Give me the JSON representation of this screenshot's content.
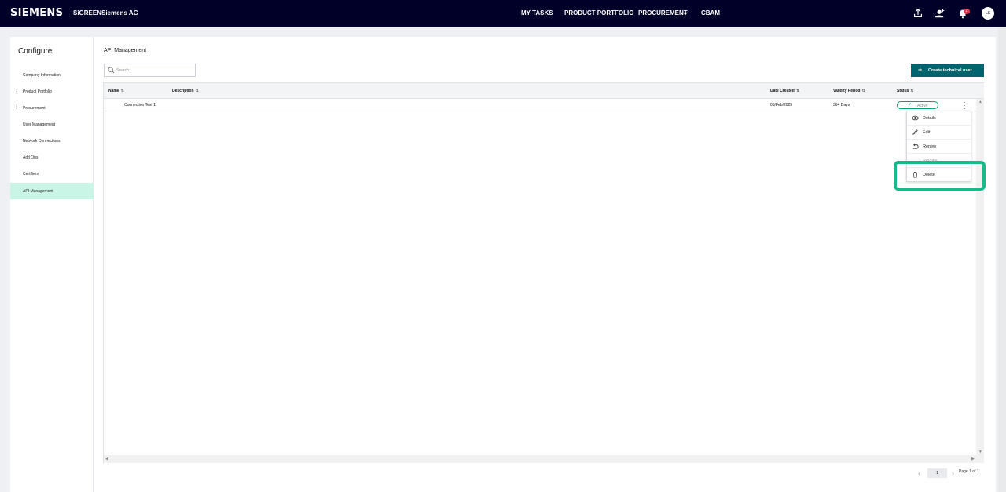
{
  "topbar": {
    "brand": "SIEMENS",
    "product": "SiGREEN",
    "organization": "Siemens AG",
    "nav": [
      "MY TASKS",
      "PRODUCT PORTFOLIO",
      "PROCUREMENT",
      "CBAM"
    ],
    "notification_count": "2",
    "avatar_initials": "LS",
    "icons": [
      "upload-icon",
      "user-add-icon",
      "bell-icon",
      "chevron-down-icon"
    ]
  },
  "sidebar": {
    "title": "Configure",
    "items": [
      {
        "label": "Company Information",
        "expandable": false
      },
      {
        "label": "Product Portfolio",
        "expandable": true
      },
      {
        "label": "Procurement",
        "expandable": true
      },
      {
        "label": "User Management",
        "expandable": false
      },
      {
        "label": "Network Connections",
        "expandable": false
      },
      {
        "label": "Add Ons",
        "expandable": false
      },
      {
        "label": "Certifiers",
        "expandable": false
      },
      {
        "label": "API Management",
        "expandable": false,
        "active": true
      }
    ]
  },
  "main": {
    "title": "API Management",
    "search": {
      "placeholder": "Search",
      "value": ""
    },
    "create_button": "Create technical user",
    "table": {
      "columns": [
        "Name",
        "Description",
        "Date Created",
        "Validity Period",
        "Status"
      ],
      "rows": [
        {
          "name": "Connection Test 1",
          "description": "",
          "date_created": "06/Feb/2025",
          "validity_period": "364 Days",
          "status": "Active"
        }
      ]
    },
    "row_menu": {
      "items": [
        "Details",
        "Edit",
        "Renew",
        "Revoke",
        "Delete"
      ],
      "highlighted": "Delete"
    },
    "pagination": {
      "current_page": "1",
      "summary": "Page 1 of 1"
    }
  },
  "colors": {
    "topbar_bg": "#000028",
    "accent": "#00646e",
    "active_nav_bg": "#c9f5e7",
    "status_active": "#00a36c",
    "highlight": "#19b98c",
    "badge": "#e2344b"
  }
}
